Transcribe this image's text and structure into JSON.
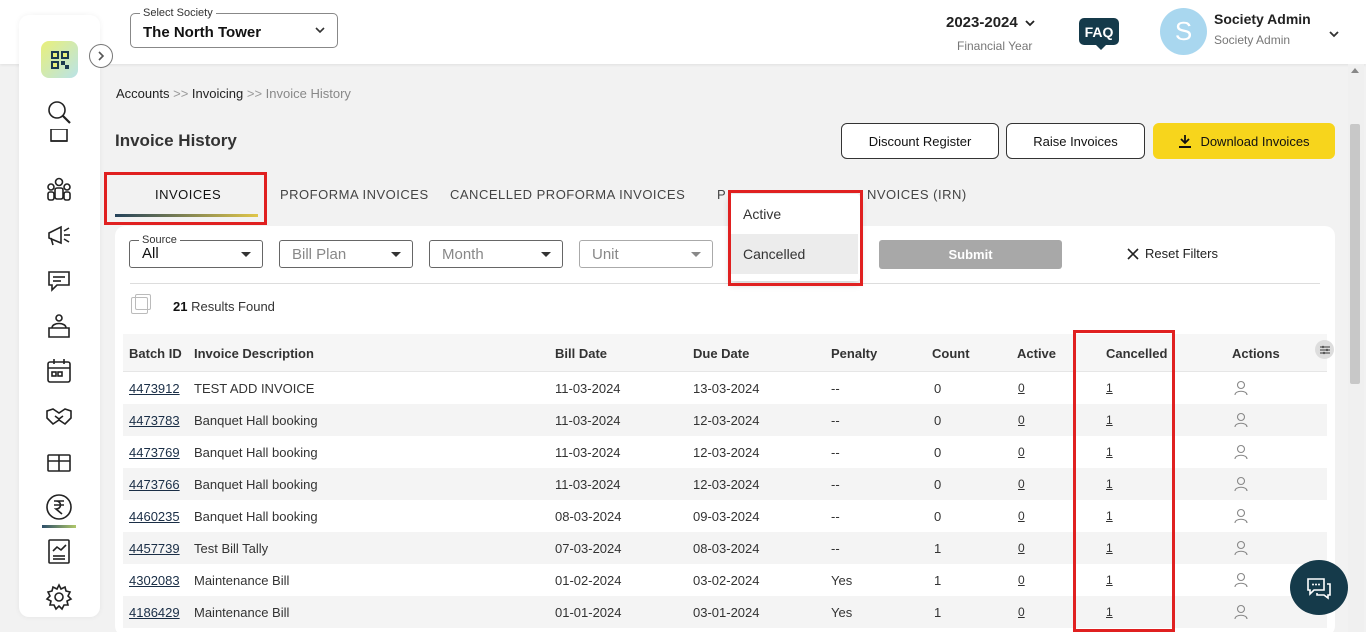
{
  "header": {
    "society_label": "Select Society",
    "society_value": "The North Tower",
    "fy_year": "2023-2024",
    "fy_label": "Financial Year",
    "faq": "FAQ",
    "avatar_letter": "S",
    "user_name": "Society Admin",
    "user_role": "Society Admin"
  },
  "breadcrumb": {
    "accounts": "Accounts",
    "sep1": ">>",
    "invoicing": "Invoicing",
    "sep2": ">>",
    "current": "Invoice History"
  },
  "page": {
    "title": "Invoice History",
    "discount_register": "Discount Register",
    "raise_invoices": "Raise Invoices",
    "download_invoices": "Download Invoices"
  },
  "tabs": {
    "invoices": "INVOICES",
    "proforma": "PROFORMA INVOICES",
    "cancelled_proforma": "CANCELLED PROFORMA INVOICES",
    "partial_left": "P",
    "partial_right": "NVOICES (IRN)"
  },
  "filters": {
    "source_label": "Source",
    "source_value": "All",
    "bill_plan": "Bill Plan",
    "month": "Month",
    "unit": "Unit",
    "submit": "Submit",
    "reset": "Reset Filters"
  },
  "status_dropdown": {
    "options": [
      "Active",
      "Cancelled"
    ],
    "selected": "Cancelled"
  },
  "results": {
    "count": "21",
    "label": "Results Found"
  },
  "table": {
    "headers": {
      "batch_id": "Batch ID",
      "description": "Invoice Description",
      "bill_date": "Bill Date",
      "due_date": "Due Date",
      "penalty": "Penalty",
      "count": "Count",
      "active": "Active",
      "cancelled": "Cancelled",
      "actions": "Actions"
    },
    "rows": [
      {
        "batch_id": "4473912",
        "description": "TEST ADD INVOICE",
        "bill_date": "11-03-2024",
        "due_date": "13-03-2024",
        "penalty": "--",
        "count": "0",
        "active": "0",
        "cancelled": "1"
      },
      {
        "batch_id": "4473783",
        "description": "Banquet Hall booking",
        "bill_date": "11-03-2024",
        "due_date": "12-03-2024",
        "penalty": "--",
        "count": "0",
        "active": "0",
        "cancelled": "1"
      },
      {
        "batch_id": "4473769",
        "description": "Banquet Hall booking",
        "bill_date": "11-03-2024",
        "due_date": "12-03-2024",
        "penalty": "--",
        "count": "0",
        "active": "0",
        "cancelled": "1"
      },
      {
        "batch_id": "4473766",
        "description": "Banquet Hall booking",
        "bill_date": "11-03-2024",
        "due_date": "12-03-2024",
        "penalty": "--",
        "count": "0",
        "active": "0",
        "cancelled": "1"
      },
      {
        "batch_id": "4460235",
        "description": "Banquet Hall booking",
        "bill_date": "08-03-2024",
        "due_date": "09-03-2024",
        "penalty": "--",
        "count": "0",
        "active": "0",
        "cancelled": "1"
      },
      {
        "batch_id": "4457739",
        "description": "Test Bill Tally",
        "bill_date": "07-03-2024",
        "due_date": "08-03-2024",
        "penalty": "--",
        "count": "1",
        "active": "0",
        "cancelled": "1"
      },
      {
        "batch_id": "4302083",
        "description": "Maintenance Bill",
        "bill_date": "01-02-2024",
        "due_date": "03-02-2024",
        "penalty": "Yes",
        "count": "1",
        "active": "0",
        "cancelled": "1"
      },
      {
        "batch_id": "4186429",
        "description": "Maintenance Bill",
        "bill_date": "01-01-2024",
        "due_date": "03-01-2024",
        "penalty": "Yes",
        "count": "1",
        "active": "0",
        "cancelled": "1"
      }
    ]
  },
  "sidebar": {
    "icons": [
      "search-icon",
      "building-icon",
      "members-icon",
      "announcement-icon",
      "chat-icon",
      "reception-icon",
      "calendar-icon",
      "handshake-icon",
      "gift-icon",
      "rupee-icon",
      "report-icon",
      "settings-icon"
    ]
  },
  "colors": {
    "accent_yellow": "#f7d51c",
    "dark_navy": "#153a4a",
    "highlight_red": "#e02020"
  }
}
